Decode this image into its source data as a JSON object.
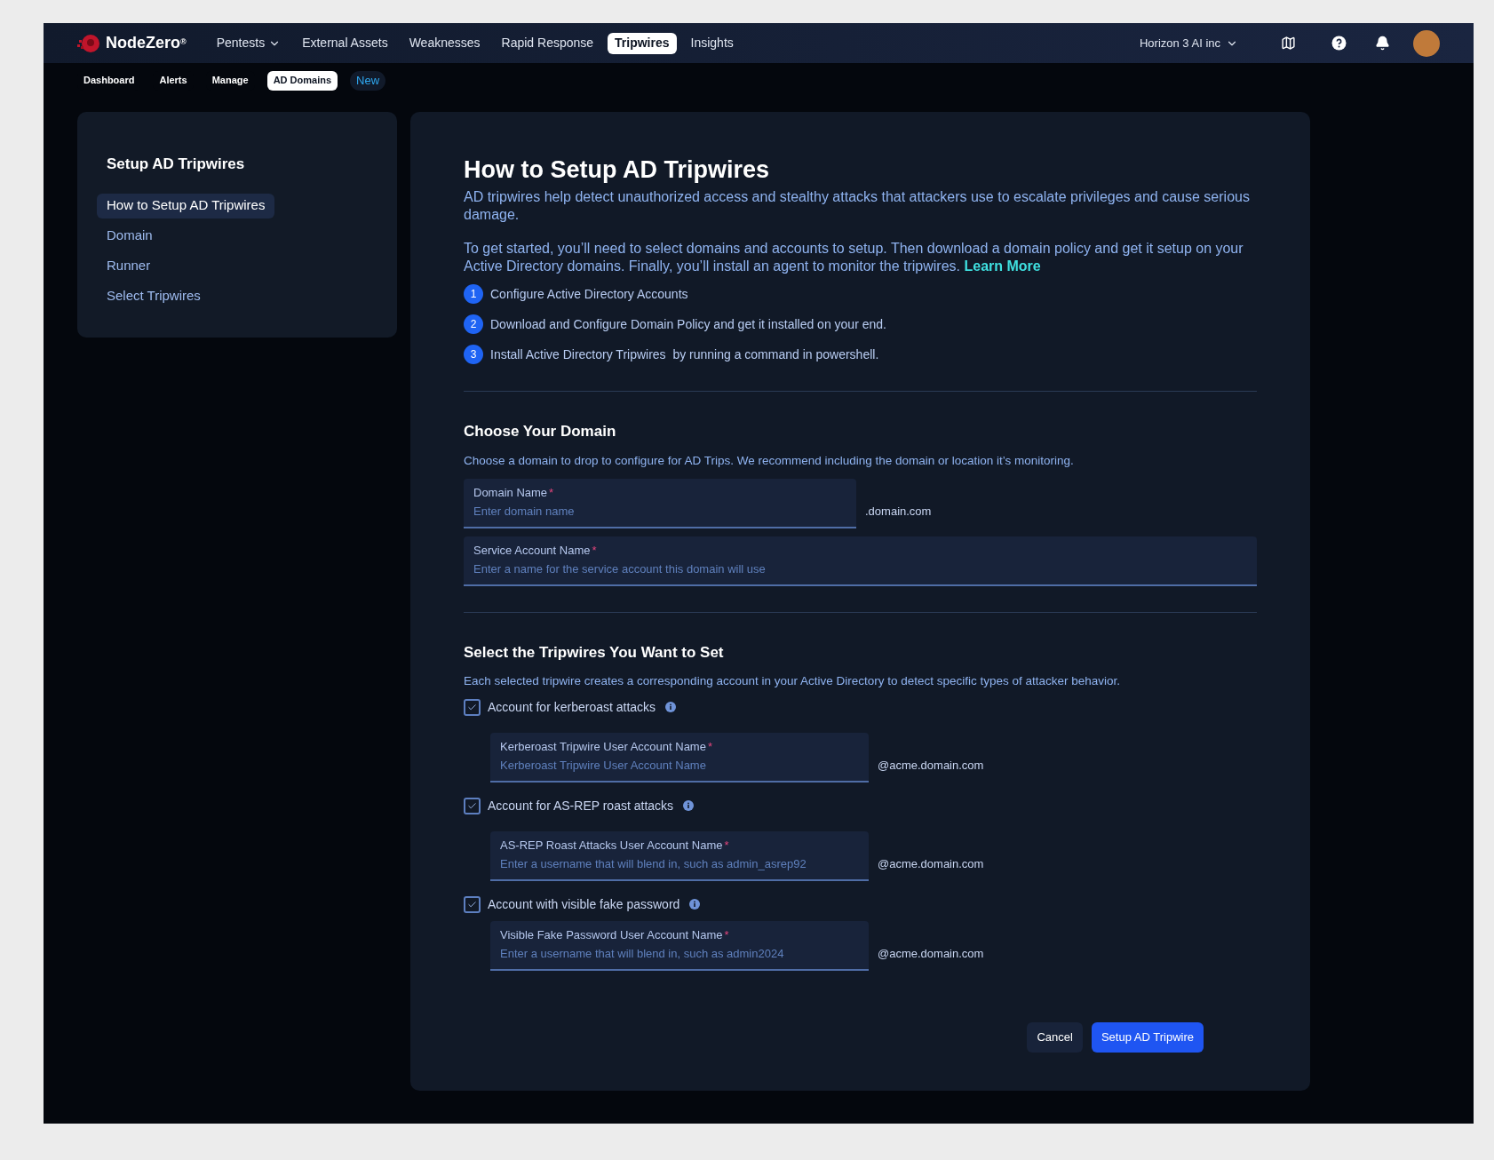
{
  "brand": {
    "name": "NodeZero",
    "mark": "®"
  },
  "nav": [
    {
      "label": "Pentests",
      "dropdown": true,
      "selected": false
    },
    {
      "label": "External Assets",
      "dropdown": false,
      "selected": false
    },
    {
      "label": "Weaknesses",
      "dropdown": false,
      "selected": false
    },
    {
      "label": "Rapid Response",
      "dropdown": false,
      "selected": false
    },
    {
      "label": "Tripwires",
      "dropdown": false,
      "selected": true
    },
    {
      "label": "Insights",
      "dropdown": false,
      "selected": false
    }
  ],
  "org": {
    "label": "Horizon 3 AI inc"
  },
  "subnav": [
    {
      "label": "Dashboard",
      "kind": "tab",
      "selected": false
    },
    {
      "label": "Alerts",
      "kind": "tab",
      "selected": false
    },
    {
      "label": "Manage",
      "kind": "tab",
      "selected": false
    },
    {
      "label": "AD Domains",
      "kind": "tab",
      "selected": true
    },
    {
      "label": "New",
      "kind": "new"
    }
  ],
  "sidebar": {
    "title": "Setup AD Tripwires",
    "items": [
      {
        "label": "How to Setup AD Tripwires",
        "selected": true
      },
      {
        "label": "Domain",
        "selected": false
      },
      {
        "label": "Runner",
        "selected": false
      },
      {
        "label": "Select Tripwires",
        "selected": false
      }
    ]
  },
  "intro": {
    "title": "How to Setup AD Tripwires",
    "paragraphs": [
      "AD tripwires help detect unauthorized access and stealthy attacks that attackers use to escalate privileges and cause serious damage.",
      "To get started, you’ll need to select domains and accounts to setup. Then download a domain policy and get it setup on your Active Directory domains. Finally, you’ll install an agent to monitor the tripwires."
    ],
    "link": "Learn More",
    "steps": [
      {
        "number": "1",
        "text": "Configure Active Directory Accounts"
      },
      {
        "number": "2",
        "text": "Download and Configure Domain Policy and get it installed on your end."
      },
      {
        "number": "3",
        "text": "Install Active Directory Tripwires  by running a command in powershell."
      }
    ]
  },
  "domain": {
    "title": "Choose Your Domain",
    "description": "Choose a domain to drop to configure for AD Trips. We recommend including the domain or location it’s monitoring.",
    "fields": [
      {
        "label": "Domain Name",
        "marker": "*",
        "placeholder": "Enter domain name",
        "suffix": ".domain.com"
      },
      {
        "label": "Service Account Name",
        "marker": "*",
        "placeholder": "Enter a name for the service account this domain will use"
      }
    ]
  },
  "tripwires": {
    "title": "Select the Tripwires You Want to Set",
    "description": "Each selected tripwire creates a corresponding account in your Active Directory to detect specific types of attacker behavior.",
    "items": [
      {
        "label": "Account for kerberoast attacks",
        "checked": true,
        "field": {
          "label": "Kerberoast Tripwire User Account Name",
          "marker": "*",
          "placeholder": "Kerberoast Tripwire User Account Name",
          "suffix": "@acme.domain.com"
        }
      },
      {
        "label": "Account for AS-REP roast attacks",
        "checked": true,
        "field": {
          "label": "AS-REP Roast Attacks User Account Name",
          "marker": "*",
          "placeholder": "Enter a username that will blend in, such as admin_asrep92",
          "suffix": "@acme.domain.com"
        }
      },
      {
        "label": "Account with visible fake password",
        "checked": true,
        "field": {
          "label": "Visible Fake Password User Account Name",
          "marker": "*",
          "placeholder": "Enter a username that will blend in, such as admin2024",
          "suffix": "@acme.domain.com"
        }
      }
    ]
  },
  "buttons": {
    "cancel": "Cancel",
    "submit": "Setup AD Tripwire"
  }
}
